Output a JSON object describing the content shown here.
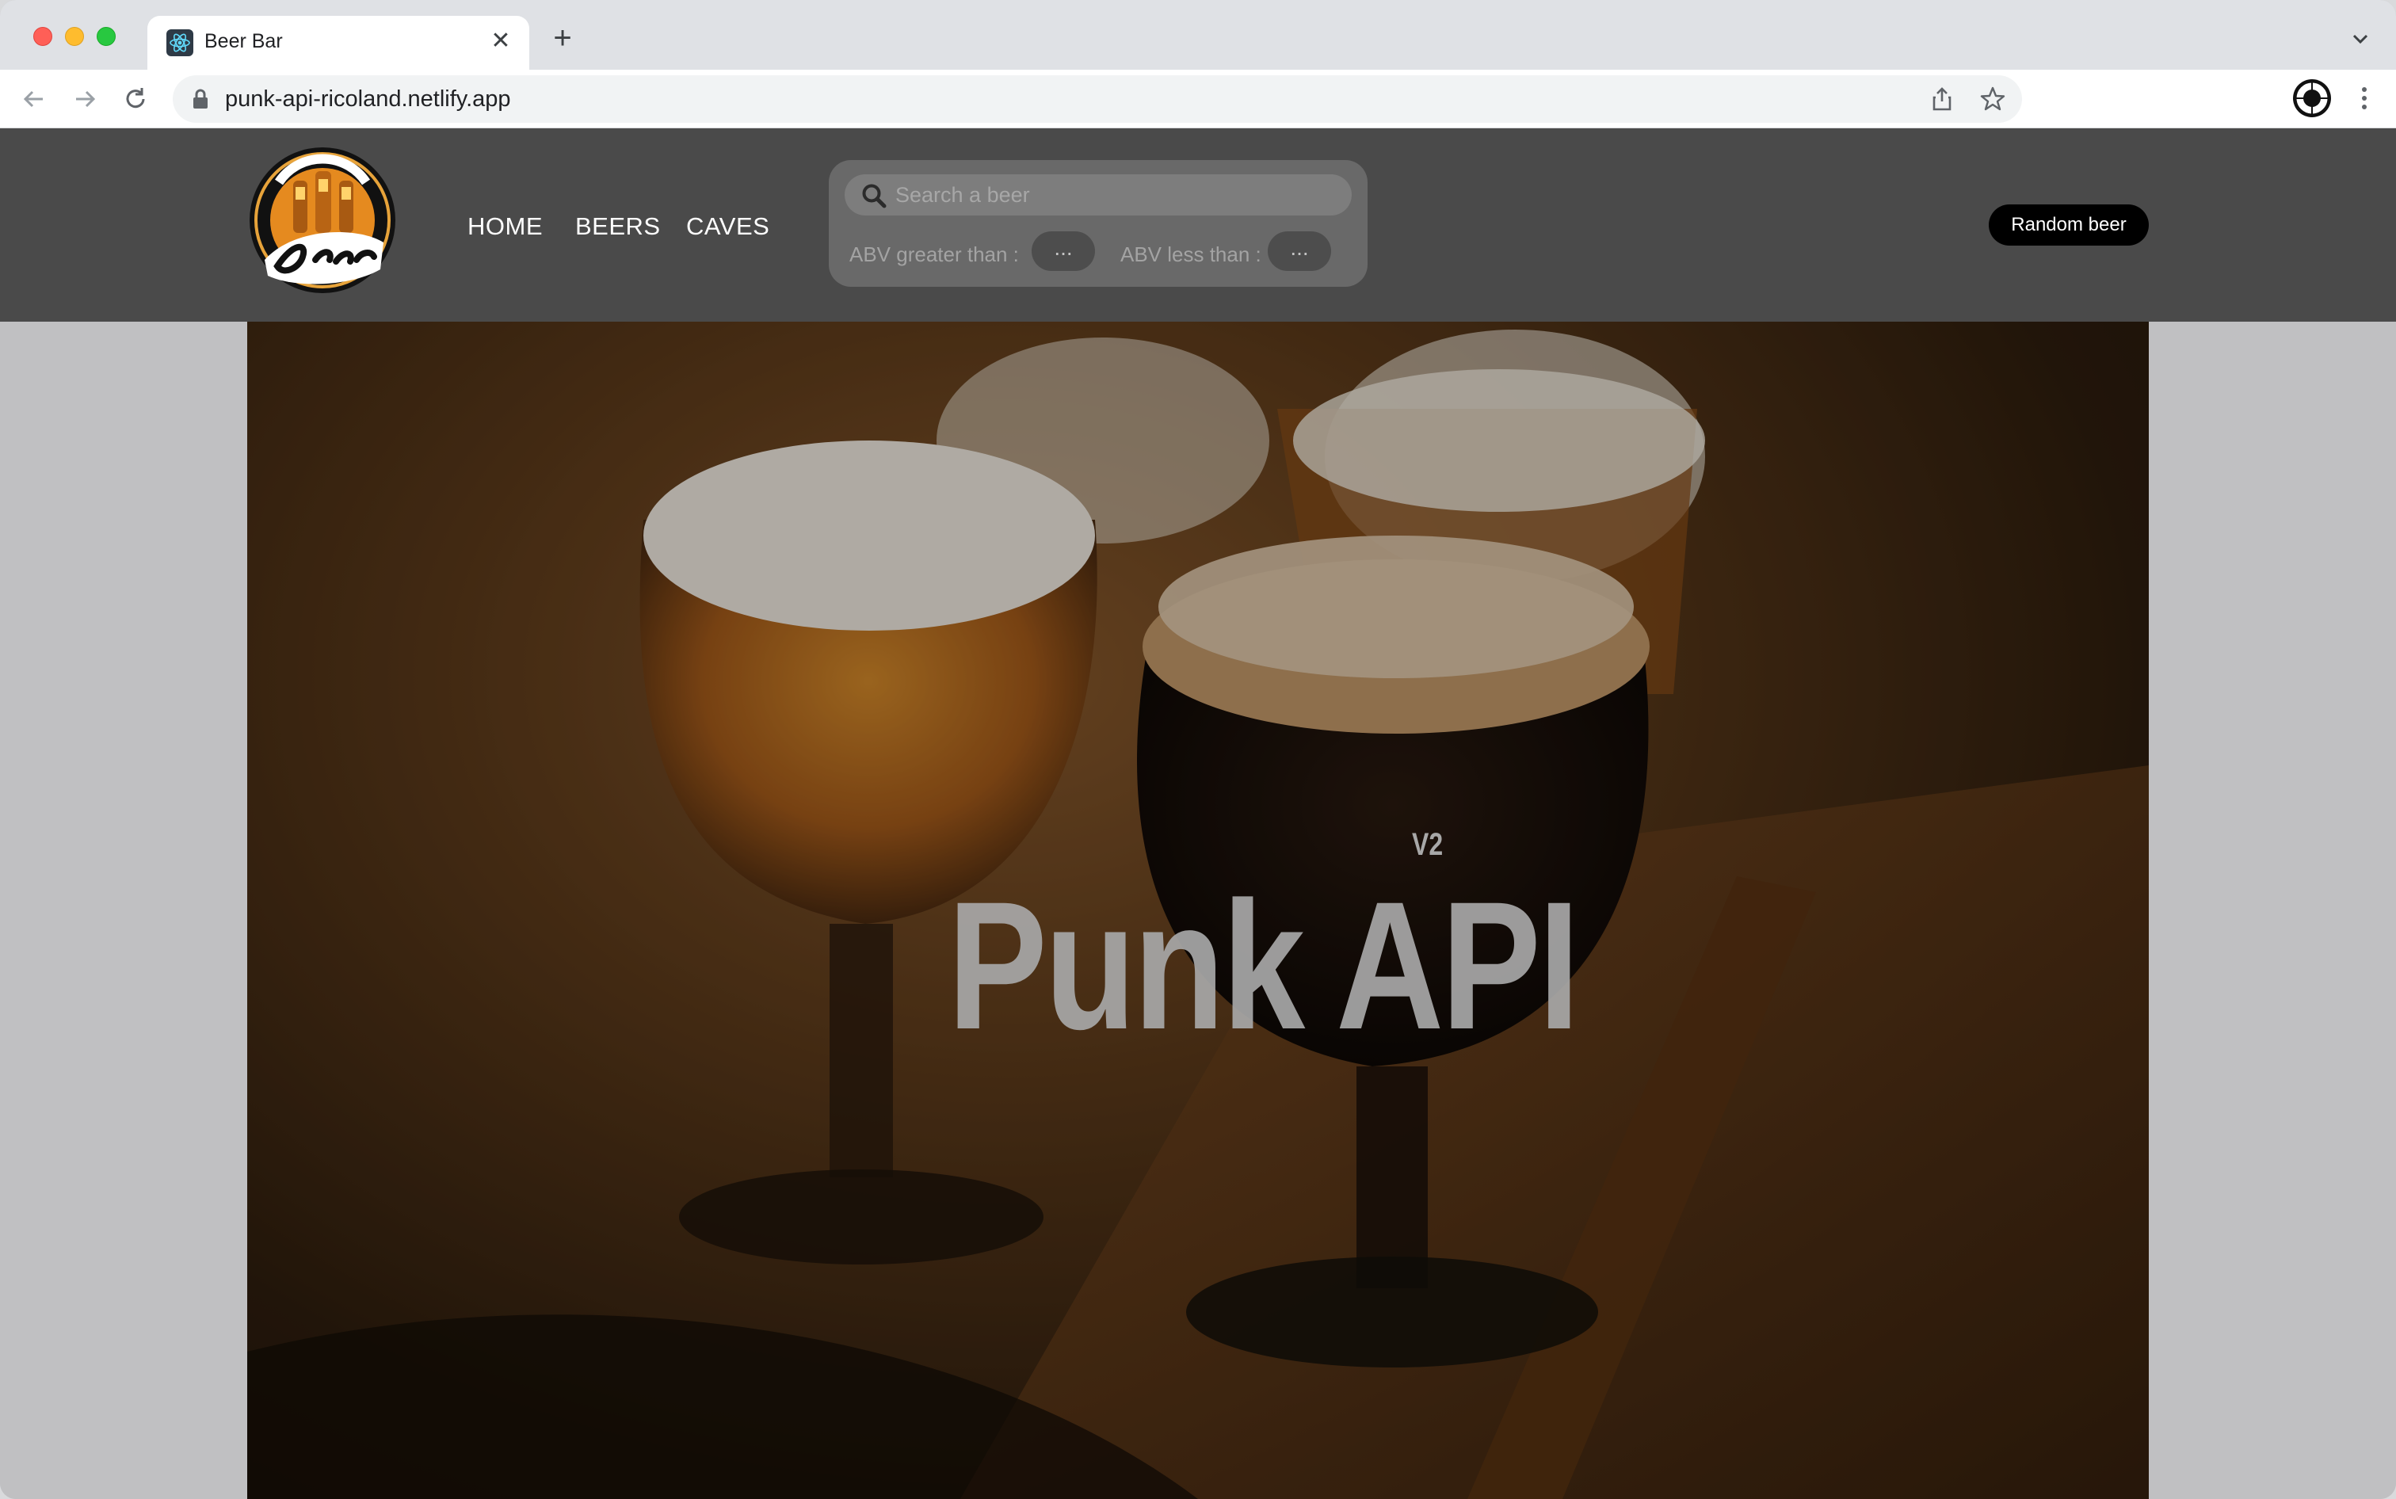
{
  "browser": {
    "tab_title": "Beer Bar",
    "url": "punk-api-ricoland.netlify.app",
    "new_tab_symbol": "+",
    "close_symbol": "✕"
  },
  "header": {
    "nav": [
      "HOME",
      "BEERS",
      "CAVES"
    ],
    "search_placeholder": "Search a beer",
    "abv_greater_label": "ABV greater than :",
    "abv_less_label": "ABV less than :",
    "abv_greater_value": "...",
    "abv_less_value": "...",
    "random_button": "Random beer"
  },
  "hero": {
    "title": "Punk API",
    "version": "V2"
  },
  "colors": {
    "header_bg": "#4a4a4a",
    "page_bg": "#c0c0c2",
    "button_bg": "#000000"
  },
  "icons": [
    "react-favicon-icon",
    "back-arrow-icon",
    "forward-arrow-icon",
    "reload-icon",
    "lock-icon",
    "share-icon",
    "bookmark-star-icon",
    "profile-icon",
    "menu-dots-icon",
    "search-icon",
    "beer-logo"
  ]
}
